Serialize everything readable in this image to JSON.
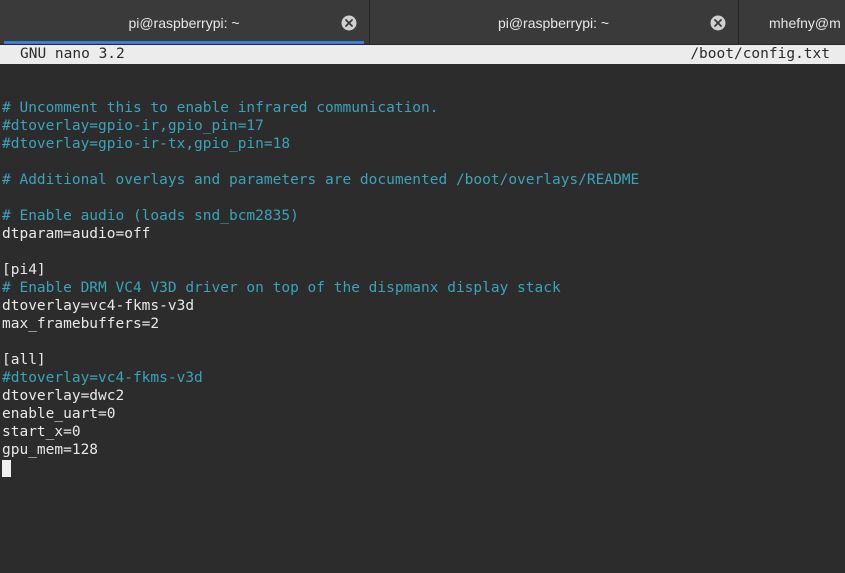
{
  "tabs": [
    {
      "label": "pi@raspberrypi: ~",
      "active": true
    },
    {
      "label": "pi@raspberrypi: ~",
      "active": false
    },
    {
      "label": "mhefny@m",
      "active": false
    }
  ],
  "nano": {
    "version": "GNU nano 3.2",
    "filename": "/boot/config.txt"
  },
  "lines": [
    {
      "text": "# Uncomment this to enable infrared communication.",
      "type": "comment"
    },
    {
      "text": "#dtoverlay=gpio-ir,gpio_pin=17",
      "type": "comment"
    },
    {
      "text": "#dtoverlay=gpio-ir-tx,gpio_pin=18",
      "type": "comment"
    },
    {
      "text": "",
      "type": "blank"
    },
    {
      "text": "# Additional overlays and parameters are documented /boot/overlays/README",
      "type": "comment"
    },
    {
      "text": "",
      "type": "blank"
    },
    {
      "text": "# Enable audio (loads snd_bcm2835)",
      "type": "comment"
    },
    {
      "text": "dtparam=audio=off",
      "type": "code"
    },
    {
      "text": "",
      "type": "blank"
    },
    {
      "text": "[pi4]",
      "type": "code"
    },
    {
      "text": "# Enable DRM VC4 V3D driver on top of the dispmanx display stack",
      "type": "comment"
    },
    {
      "text": "dtoverlay=vc4-fkms-v3d",
      "type": "code"
    },
    {
      "text": "max_framebuffers=2",
      "type": "code"
    },
    {
      "text": "",
      "type": "blank"
    },
    {
      "text": "[all]",
      "type": "code"
    },
    {
      "text": "#dtoverlay=vc4-fkms-v3d",
      "type": "comment"
    },
    {
      "text": "dtoverlay=dwc2",
      "type": "code"
    },
    {
      "text": "enable_uart=0",
      "type": "code"
    },
    {
      "text": "start_x=0",
      "type": "code"
    },
    {
      "text": "gpu_mem=128",
      "type": "code"
    }
  ],
  "colors": {
    "comment": "#3aa3b8",
    "text": "#e8e8e8",
    "background": "#2c2c2c",
    "header_bg": "#ececec",
    "tab_active_accent": "#3d7fd6"
  }
}
